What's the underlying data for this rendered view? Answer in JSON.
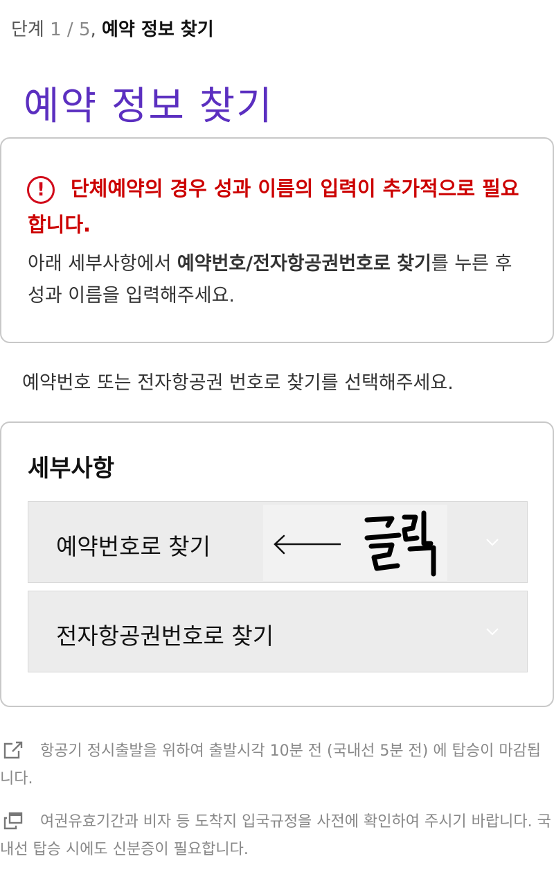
{
  "step": {
    "prefix": "단계",
    "progress": "1 / 5",
    "separator": ",",
    "current": "예약 정보 찾기"
  },
  "page_title": "예약 정보 찾기",
  "notice": {
    "warning_icon": "exclamation-circle-icon",
    "warning_text": "단체예약의 경우 성과 이름의 입력이 추가적으로 필요합니다.",
    "desc_pre": "아래 세부사항에서 ",
    "desc_bold": "예약번호/전자항공권번호로 찾기",
    "desc_post": "를 누른 후 성과 이름을 입력해주세요."
  },
  "guide_text": "예약번호 또는 전자항공권 번호로 찾기를 선택해주세요.",
  "details": {
    "title": "세부사항",
    "items": [
      {
        "label": "예약번호로 찾기",
        "icon": "chevron-down-icon"
      },
      {
        "label": "전자항공권번호로 찾기",
        "icon": "chevron-down-icon"
      }
    ]
  },
  "annotation": {
    "handwritten": "클릭",
    "arrow": "left-arrow"
  },
  "footer": [
    {
      "icon": "external-link-icon",
      "text": "항공기 정시출발을 위하여 출발시각 10분 전 (국내선 5분 전) 에 탑승이 마감됩니다."
    },
    {
      "icon": "new-window-icon",
      "text": "여권유효기간과 비자 등 도착지 입국규정을 사전에 확인하여 주시기 바랍니다. 국내선 탑승 시에도 신분증이 필요합니다."
    }
  ],
  "colors": {
    "title_purple": "#5b2fc0",
    "warning_red": "#cc0000",
    "accordion_bg": "#ececec",
    "border": "#c8c8c8"
  }
}
